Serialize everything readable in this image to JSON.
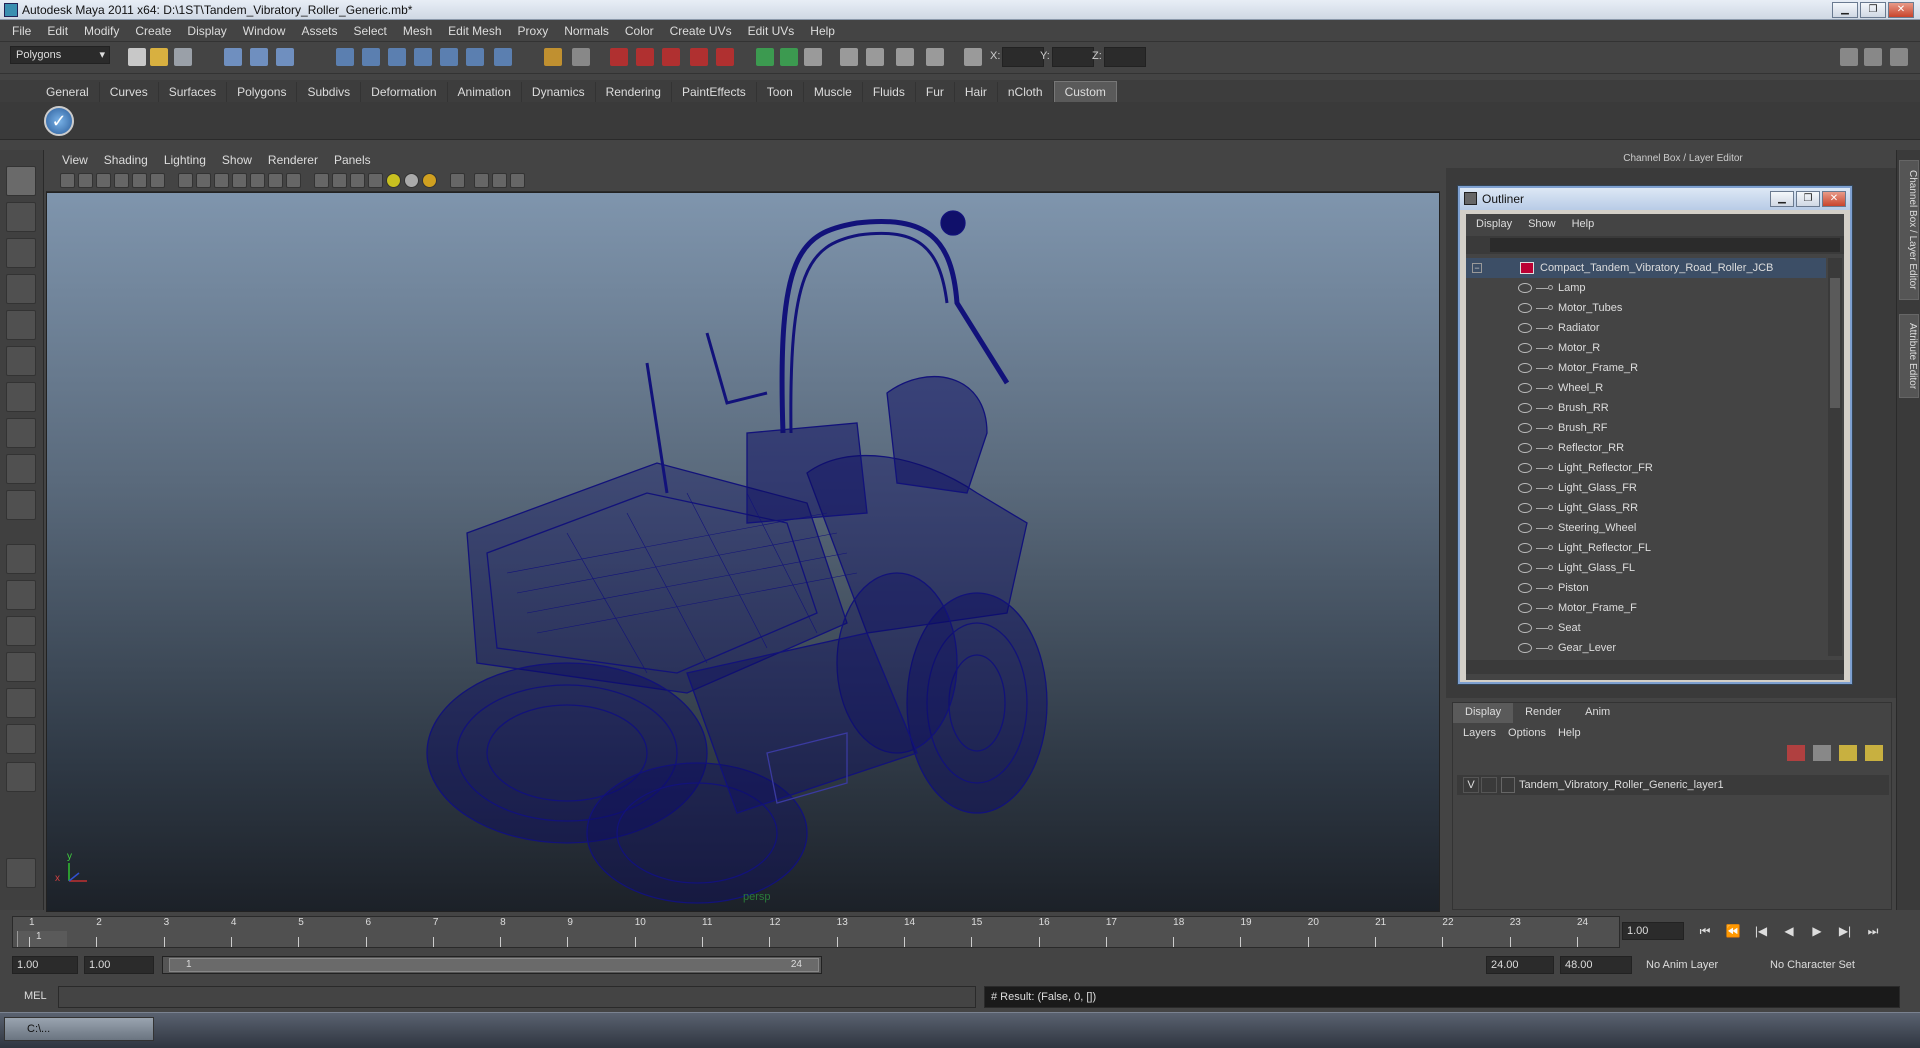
{
  "window": {
    "title": "Autodesk Maya 2011 x64: D:\\1ST\\Tandem_Vibratory_Roller_Generic.mb*"
  },
  "menus": [
    "File",
    "Edit",
    "Modify",
    "Create",
    "Display",
    "Window",
    "Assets",
    "Select",
    "Mesh",
    "Edit Mesh",
    "Proxy",
    "Normals",
    "Color",
    "Create UVs",
    "Edit UVs",
    "Help"
  ],
  "status": {
    "mode": "Polygons",
    "x_label": "X:",
    "y_label": "Y:",
    "z_label": "Z:"
  },
  "shelf_tabs": [
    "General",
    "Curves",
    "Surfaces",
    "Polygons",
    "Subdivs",
    "Deformation",
    "Animation",
    "Dynamics",
    "Rendering",
    "PaintEffects",
    "Toon",
    "Muscle",
    "Fluids",
    "Fur",
    "Hair",
    "nCloth",
    "Custom"
  ],
  "active_shelf": "Custom",
  "viewport": {
    "menus": [
      "View",
      "Shading",
      "Lighting",
      "Show",
      "Renderer",
      "Panels"
    ],
    "camera_label": "persp",
    "axis_x": "x",
    "axis_y": "y",
    "wire_color": "#0d0d6e"
  },
  "right_panel": {
    "title": "Channel Box / Layer Editor",
    "side_tabs": [
      "Channel Box / Layer Editor",
      "Attribute Editor"
    ]
  },
  "outliner": {
    "title": "Outliner",
    "menus": [
      "Display",
      "Show",
      "Help"
    ],
    "root": "Compact_Tandem_Vibratory_Road_Roller_JCB",
    "items": [
      "Lamp",
      "Motor_Tubes",
      "Radiator",
      "Motor_R",
      "Motor_Frame_R",
      "Wheel_R",
      "Brush_RR",
      "Brush_RF",
      "Reflector_RR",
      "Light_Reflector_FR",
      "Light_Glass_FR",
      "Light_Glass_RR",
      "Steering_Wheel",
      "Light_Reflector_FL",
      "Light_Glass_FL",
      "Piston",
      "Motor_Frame_F",
      "Seat",
      "Gear_Lever"
    ]
  },
  "layer_editor": {
    "tabs": [
      "Display",
      "Render",
      "Anim"
    ],
    "menus": [
      "Layers",
      "Options",
      "Help"
    ],
    "visible_flag": "V",
    "layer_name": "Tandem_Vibratory_Roller_Generic_layer1"
  },
  "timeline": {
    "ticks": [
      "1",
      "2",
      "3",
      "4",
      "5",
      "6",
      "7",
      "8",
      "9",
      "10",
      "11",
      "12",
      "13",
      "14",
      "15",
      "16",
      "17",
      "18",
      "19",
      "20",
      "21",
      "22",
      "23",
      "24"
    ],
    "current_frame_field": "1",
    "current_time": "1.00"
  },
  "range": {
    "start": "1.00",
    "playback_start": "1.00",
    "slider_start": "1",
    "slider_end": "24",
    "playback_end": "24.00",
    "end": "48.00",
    "anim_layer": "No Anim Layer",
    "character_set": "No Character Set"
  },
  "command": {
    "label": "MEL",
    "result": "# Result: (False, 0, [])"
  },
  "taskbar": {
    "item": "C:\\..."
  }
}
